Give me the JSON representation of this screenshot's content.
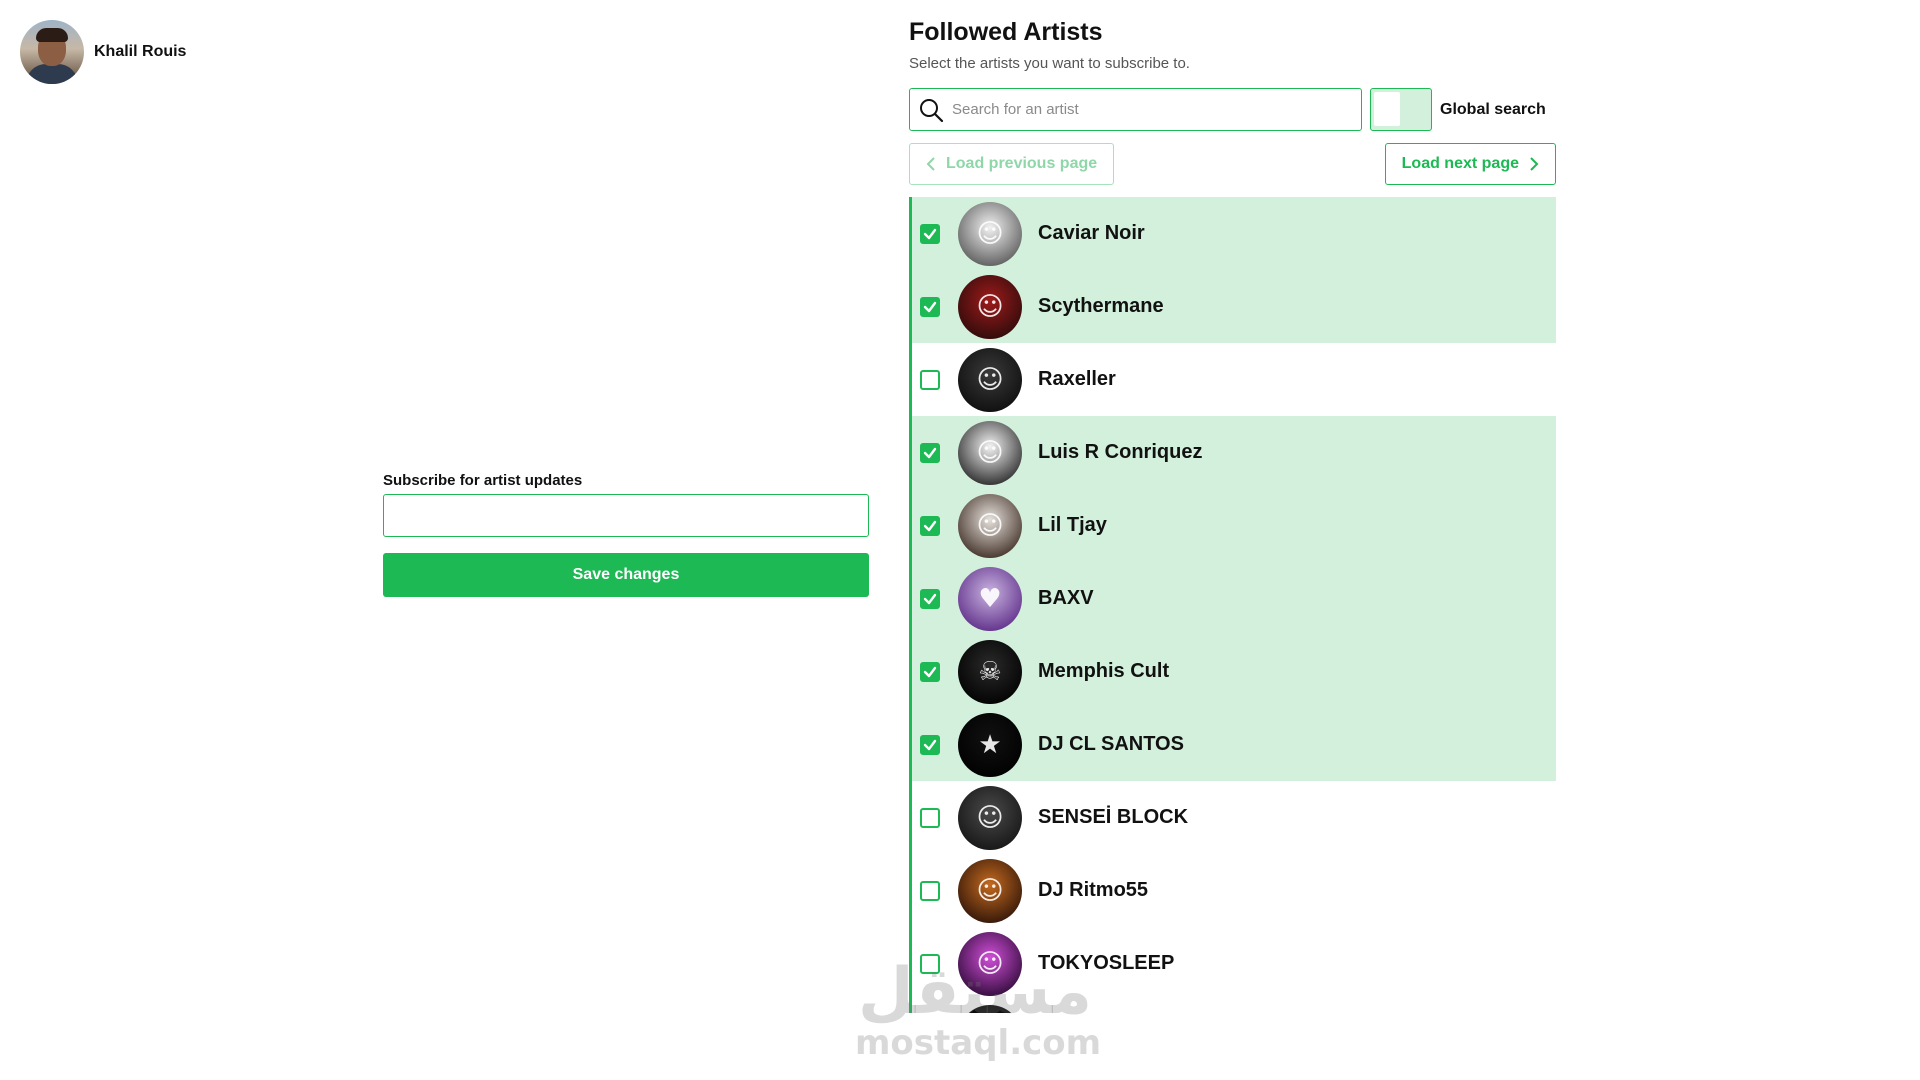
{
  "user": {
    "name": "Khalil Rouis"
  },
  "form": {
    "label": "Subscribe for artist updates",
    "value": "",
    "placeholder": "",
    "save_label": "Save changes"
  },
  "panel": {
    "title": "Followed Artists",
    "subtitle": "Select the artists you want to subscribe to.",
    "search_placeholder": "Search for an artist",
    "global_search_label": "Global search",
    "global_search_on": false,
    "prev_label": "Load previous page",
    "next_label": "Load next page",
    "prev_disabled": true
  },
  "artists": [
    {
      "name": "Caviar Noir",
      "checked": true,
      "avatar_colors": [
        "#f2f2f2",
        "#555555"
      ],
      "icon": "person-icon"
    },
    {
      "name": "Scythermane",
      "checked": true,
      "avatar_colors": [
        "#9e1b1b",
        "#2a0a0a"
      ],
      "icon": "person-icon"
    },
    {
      "name": "Raxeller",
      "checked": false,
      "avatar_colors": [
        "#3a3a3a",
        "#0d0d0d"
      ],
      "icon": "person-icon"
    },
    {
      "name": "Luis R Conriquez",
      "checked": true,
      "avatar_colors": [
        "#f4f4f4",
        "#222222"
      ],
      "icon": "person-icon"
    },
    {
      "name": "Lil Tjay",
      "checked": true,
      "avatar_colors": [
        "#e6e1dc",
        "#3b2a20"
      ],
      "icon": "person-icon"
    },
    {
      "name": "BAXV",
      "checked": true,
      "avatar_colors": [
        "#c9b3e0",
        "#5b2a86"
      ],
      "icon": "heart-icon"
    },
    {
      "name": "Memphis Cult",
      "checked": true,
      "avatar_colors": [
        "#2a2a2a",
        "#000000"
      ],
      "icon": "skull-icon"
    },
    {
      "name": "DJ CL SANTOS",
      "checked": true,
      "avatar_colors": [
        "#111111",
        "#000000"
      ],
      "icon": "logo-icon"
    },
    {
      "name": "SENSEİ BLOCK",
      "checked": false,
      "avatar_colors": [
        "#4a4a4a",
        "#141414"
      ],
      "icon": "person-icon"
    },
    {
      "name": "DJ Ritmo55",
      "checked": false,
      "avatar_colors": [
        "#c46a1f",
        "#2b1208"
      ],
      "icon": "person-icon"
    },
    {
      "name": "TOKYOSLEEP",
      "checked": false,
      "avatar_colors": [
        "#d04fd8",
        "#2a0833"
      ],
      "icon": "person-icon"
    },
    {
      "name": "",
      "checked": false,
      "avatar_colors": [
        "#1a1a1a",
        "#000000"
      ],
      "icon": "person-icon"
    }
  ],
  "watermark": {
    "arabic": "مستقل",
    "latin": "mostaql.com"
  },
  "colors": {
    "accent": "#1db954",
    "selected_row": "#d2f0dc"
  }
}
